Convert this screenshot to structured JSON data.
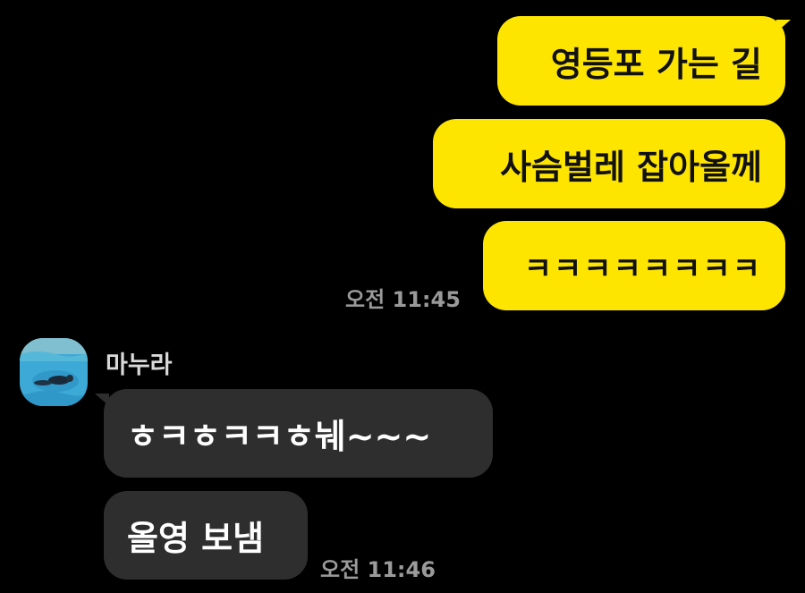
{
  "chat": {
    "colors": {
      "background": "#000000",
      "outgoing_bubble": "#FEE500",
      "incoming_bubble": "#2E2E2E",
      "timestamp": "#9A9A9A"
    },
    "outgoing": {
      "messages": [
        "영등포 가는 길",
        "사슴벌레 잡아올께",
        "ㅋㅋㅋㅋㅋㅋㅋㅋ"
      ],
      "timestamp": "오전 11:45"
    },
    "incoming": {
      "sender_name": "마누라",
      "avatar_icon": "profile-photo-pool",
      "messages": [
        "ㅎㅋㅎㅋㅋㅎ눼~~~",
        "올영 보냄"
      ],
      "timestamp": "오전 11:46"
    }
  }
}
